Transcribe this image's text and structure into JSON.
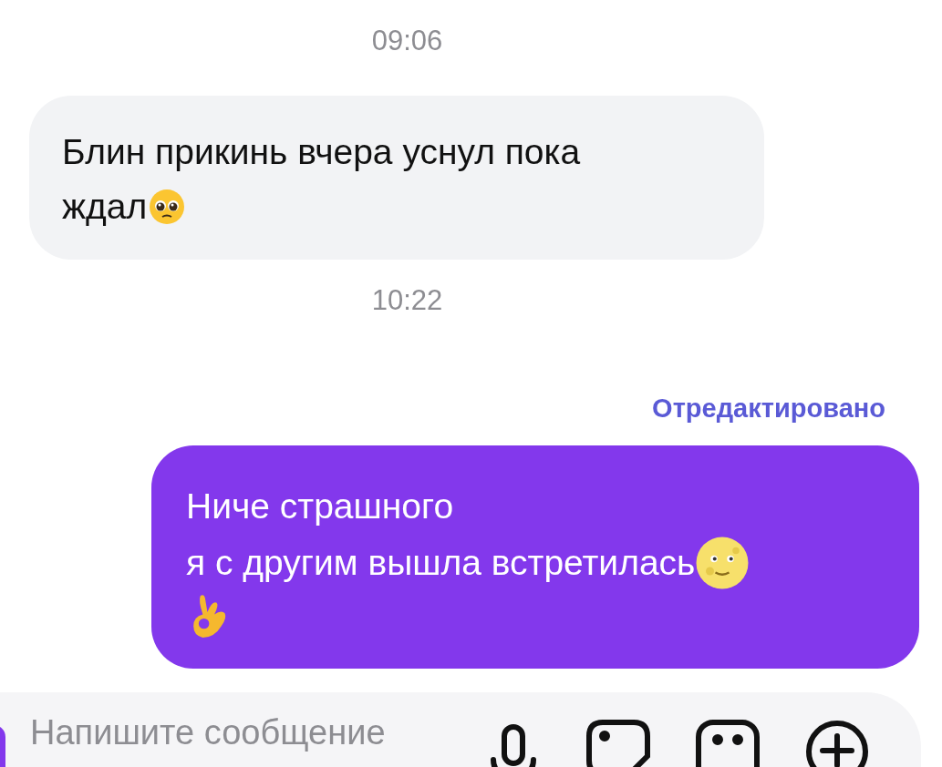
{
  "messages": [
    {
      "kind": "time",
      "text": "09:06"
    },
    {
      "kind": "incoming",
      "lines": [
        "Блин прикинь вчера уснул пока",
        "ждал"
      ]
    },
    {
      "kind": "time",
      "text": "10:22"
    },
    {
      "kind": "edited",
      "text": "Отредактировано"
    },
    {
      "kind": "outgoing",
      "lines": [
        "Ниче страшного",
        "я с другим вышла встретилась"
      ]
    }
  ],
  "composer": {
    "placeholder": "Напишите сообщение"
  }
}
